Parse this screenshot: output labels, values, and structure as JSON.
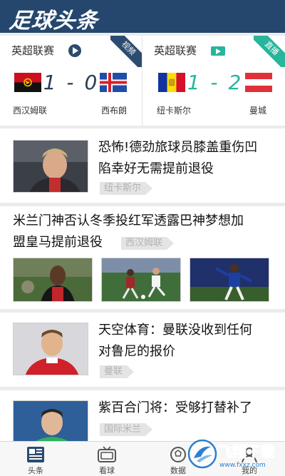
{
  "app": {
    "logo_text": "足球头条"
  },
  "matches": [
    {
      "league": "英超联赛",
      "ribbon": "视频",
      "home_team": "西汉姆联",
      "away_team": "西布朗",
      "score": "1 - 0"
    },
    {
      "league": "英超联赛",
      "ribbon": "直播",
      "home_team": "纽卡斯尔",
      "away_team": "曼城",
      "score": "1 - 2"
    }
  ],
  "news": [
    {
      "title_line1": "恐怖!德劲旅球员膝盖重伤凹",
      "title_line2": "陷幸好无需提前退役",
      "tag": "纽卡斯尔"
    },
    {
      "title_line1": "米兰门神否认冬季投红军透露巴神梦想加",
      "title_line2": "盟皇马提前退役",
      "tag": "西汉姆联"
    },
    {
      "title_line1": "天空体育：曼联没收到任何",
      "title_line2": "对鲁尼的报价",
      "tag": "曼联"
    },
    {
      "title_line1": "紫百合门将：受够打替补了",
      "title_line2": "",
      "tag": "国际米兰"
    }
  ],
  "bottom_nav": [
    {
      "label": "头条",
      "icon": "newspaper-icon"
    },
    {
      "label": "看球",
      "icon": "tv-icon"
    },
    {
      "label": "数据",
      "icon": "data-icon"
    },
    {
      "label": "我的",
      "icon": "profile-icon"
    }
  ],
  "watermark": {
    "text": "飞翔下载",
    "url": "www.fxxz.com"
  },
  "colors": {
    "header": "#25476d",
    "accent_teal": "#27b59b",
    "tag_bg": "#e4e4e4",
    "tag_text": "#b3b3b3"
  }
}
